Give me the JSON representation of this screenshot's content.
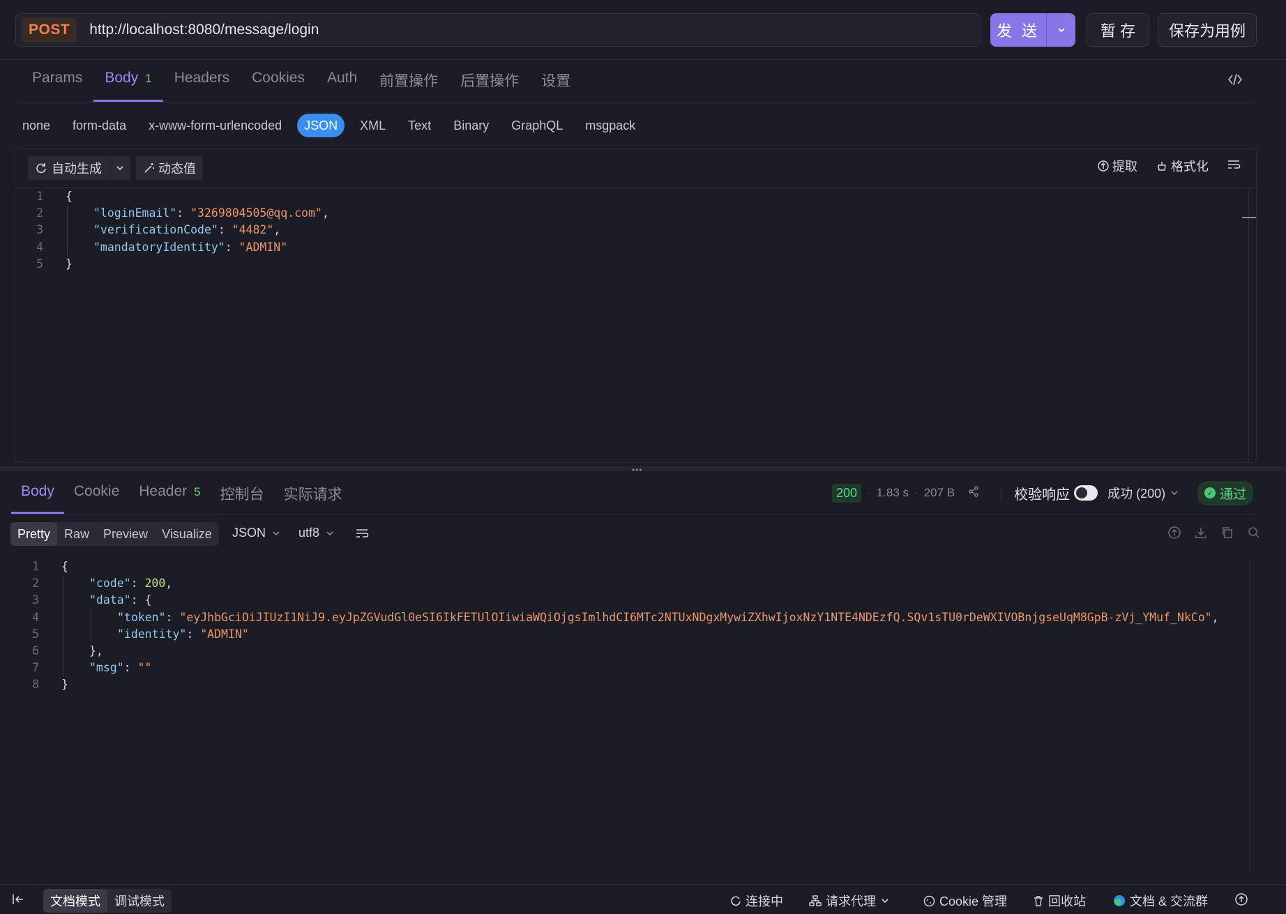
{
  "request": {
    "method": "POST",
    "url": "http://localhost:8080/message/login",
    "send_label": "发 送",
    "stash_label": "暂 存",
    "save_case_label": "保存为用例"
  },
  "req_tabs": [
    {
      "label": "Params"
    },
    {
      "label": "Body",
      "badge": "1"
    },
    {
      "label": "Headers"
    },
    {
      "label": "Cookies"
    },
    {
      "label": "Auth"
    },
    {
      "label": "前置操作"
    },
    {
      "label": "后置操作"
    },
    {
      "label": "设置"
    }
  ],
  "body_types": [
    "none",
    "form-data",
    "x-www-form-urlencoded",
    "JSON",
    "XML",
    "Text",
    "Binary",
    "GraphQL",
    "msgpack"
  ],
  "body_type_selected": "JSON",
  "editor_toolbar": {
    "auto_generate": "自动生成",
    "dynamic_value": "动态值",
    "extract": "提取",
    "format": "格式化"
  },
  "request_body_lines": [
    {
      "n": "1",
      "indent": 0,
      "parts": [
        {
          "t": "{",
          "c": "p"
        }
      ]
    },
    {
      "n": "2",
      "indent": 1,
      "parts": [
        {
          "t": "\"loginEmail\"",
          "c": "k"
        },
        {
          "t": ": ",
          "c": "p"
        },
        {
          "t": "\"3269804505@qq.com\"",
          "c": "s"
        },
        {
          "t": ",",
          "c": "p"
        }
      ]
    },
    {
      "n": "3",
      "indent": 1,
      "parts": [
        {
          "t": "\"verificationCode\"",
          "c": "k"
        },
        {
          "t": ": ",
          "c": "p"
        },
        {
          "t": "\"4482\"",
          "c": "s"
        },
        {
          "t": ",",
          "c": "p"
        }
      ]
    },
    {
      "n": "4",
      "indent": 1,
      "parts": [
        {
          "t": "\"mandatoryIdentity\"",
          "c": "k"
        },
        {
          "t": ": ",
          "c": "p"
        },
        {
          "t": "\"ADMIN\"",
          "c": "s"
        }
      ]
    },
    {
      "n": "5",
      "indent": 0,
      "parts": [
        {
          "t": "}",
          "c": "p"
        }
      ]
    }
  ],
  "resp_tabs": [
    {
      "label": "Body"
    },
    {
      "label": "Cookie"
    },
    {
      "label": "Header",
      "badge": "5"
    },
    {
      "label": "控制台"
    },
    {
      "label": "实际请求"
    }
  ],
  "response_meta": {
    "status": "200",
    "time": "1.83 s",
    "size": "207 B",
    "validate_label": "校验响应",
    "result_label": "成功 (200)",
    "pass_label": "通过"
  },
  "view_modes": [
    "Pretty",
    "Raw",
    "Preview",
    "Visualize"
  ],
  "view_mode_selected": "Pretty",
  "format_dropdown": "JSON",
  "encoding_dropdown": "utf8",
  "response_body_lines": [
    {
      "n": "1",
      "indent": 0,
      "parts": [
        {
          "t": "{",
          "c": "p"
        }
      ]
    },
    {
      "n": "2",
      "indent": 1,
      "parts": [
        {
          "t": "\"code\"",
          "c": "k"
        },
        {
          "t": ": ",
          "c": "p"
        },
        {
          "t": "200",
          "c": "n"
        },
        {
          "t": ",",
          "c": "p"
        }
      ]
    },
    {
      "n": "3",
      "indent": 1,
      "parts": [
        {
          "t": "\"data\"",
          "c": "k"
        },
        {
          "t": ": {",
          "c": "p"
        }
      ]
    },
    {
      "n": "4",
      "indent": 2,
      "parts": [
        {
          "t": "\"token\"",
          "c": "k"
        },
        {
          "t": ": ",
          "c": "p"
        },
        {
          "t": "\"eyJhbGciOiJIUzI1NiJ9.eyJpZGVudGl0eSI6IkFETUlOIiwiaWQiOjgsImlhdCI6MTc2NTUxNDgxMywiZXhwIjoxNzY1NTE4NDEzfQ.SQv1sTU0rDeWXIVOBnjgseUqM8GpB-zVj_YMuf_NkCo\"",
          "c": "s"
        },
        {
          "t": ",",
          "c": "p"
        }
      ]
    },
    {
      "n": "5",
      "indent": 2,
      "parts": [
        {
          "t": "\"identity\"",
          "c": "k"
        },
        {
          "t": ": ",
          "c": "p"
        },
        {
          "t": "\"ADMIN\"",
          "c": "s"
        }
      ]
    },
    {
      "n": "6",
      "indent": 1,
      "parts": [
        {
          "t": "},",
          "c": "p"
        }
      ]
    },
    {
      "n": "7",
      "indent": 1,
      "parts": [
        {
          "t": "\"msg\"",
          "c": "k"
        },
        {
          "t": ": ",
          "c": "p"
        },
        {
          "t": "\"\"",
          "c": "s"
        }
      ]
    },
    {
      "n": "8",
      "indent": 0,
      "parts": [
        {
          "t": "}",
          "c": "p"
        }
      ]
    }
  ],
  "footer": {
    "doc_mode": "文档模式",
    "debug_mode": "调试模式",
    "connecting": "连接中",
    "proxy": "请求代理",
    "cookie_mgmt": "Cookie 管理",
    "recycle": "回收站",
    "docs_group": "文档 & 交流群"
  },
  "icons": {
    "send_dropdown": "chevron-down-icon",
    "code_view": "code-icon",
    "refresh": "refresh-icon",
    "magic": "magic-wand-icon",
    "extract": "upload-icon",
    "format": "broom-icon",
    "wrap": "wrap-lines-icon",
    "share": "share-icon"
  }
}
